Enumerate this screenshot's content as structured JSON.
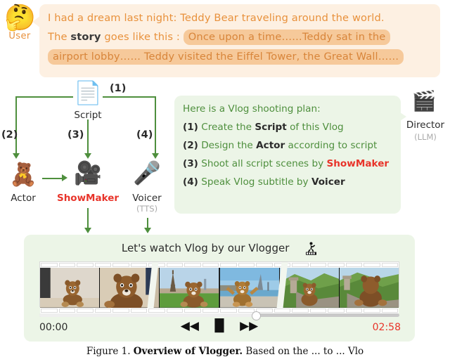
{
  "user": {
    "avatar_icon": "thinking-face-emoji",
    "label": "User",
    "prompt": {
      "line1": "I had a dream last night: Teddy Bear traveling around the world.",
      "line2_pre": "The ",
      "line2_bold": "story",
      "line2_mid": " goes like this : ",
      "line2_highlight": "Once upon a time……Teddy sat in the",
      "line3_highlight": "airport lobby…… Teddy visited the Eiffel Tower, the Great Wall……"
    }
  },
  "diagram": {
    "script": {
      "label": "Script",
      "icon": "document-page-icon"
    },
    "actor": {
      "label": "Actor",
      "icon": "teddy-bear-icon"
    },
    "showmaker": {
      "label": "ShowMaker",
      "icon": "video-camera-icon"
    },
    "voicer": {
      "label": "Voicer",
      "sub": "(TTS)",
      "icon": "microphone-icon"
    },
    "director": {
      "label": "Director",
      "sub": "(LLM)",
      "icon": "clapper-board-icon"
    },
    "steps": [
      "(1)",
      "(2)",
      "(3)",
      "(4)"
    ]
  },
  "plan": {
    "heading": "Here is a Vlog shooting plan:",
    "items": [
      {
        "num": "(1)",
        "pre": "Create the ",
        "kw": "Script",
        "kw_style": "bold",
        "post": " of this Vlog"
      },
      {
        "num": "(2)",
        "pre": "Design the ",
        "kw": "Actor",
        "kw_style": "bold",
        "post": " according to script"
      },
      {
        "num": "(3)",
        "pre": "Shoot all script scenes by ",
        "kw": "ShowMaker",
        "kw_style": "red",
        "post": ""
      },
      {
        "num": "(4)",
        "pre": "Speak Vlog subtitle by ",
        "kw": "Voicer",
        "kw_style": "bold",
        "post": ""
      }
    ]
  },
  "player": {
    "title": "Let's watch Vlog by our Vlogger",
    "logo_icon": "crescent-moon-runner-icon",
    "time_start": "00:00",
    "time_end": "02:58",
    "progress_percent": 60,
    "controls": [
      {
        "name": "rewind-button",
        "glyph": "◀◀"
      },
      {
        "name": "pause-button",
        "glyph": "▐▌"
      },
      {
        "name": "fast-forward-button",
        "glyph": "▶▶"
      }
    ],
    "frames": [
      {
        "name": "frame-indoor-teddy-1",
        "scene": "teddy bear on indoor floor"
      },
      {
        "name": "frame-indoor-teddy-2",
        "scene": "teddy bear closeup indoor"
      },
      {
        "name": "frame-eiffel-teddy",
        "scene": "teddy bear on grass by Eiffel Tower"
      },
      {
        "name": "frame-harbor-teddy",
        "scene": "teddy bear at harbor waterfront"
      },
      {
        "name": "frame-greatwall-teddy-1",
        "scene": "teddy bear on Great Wall ridge"
      },
      {
        "name": "frame-greatwall-teddy-2",
        "scene": "teddy bear back view on Great Wall"
      }
    ]
  },
  "caption": {
    "prefix": "Figure 1. ",
    "bold": "Overview of Vlogger.",
    "rest": " Based on the ... to ... Vlo"
  },
  "colors": {
    "orange": "#e8913c",
    "orange_highlight": "#f6c99a",
    "bubble_bg": "#fdf0e2",
    "green": "#4e8f3d",
    "green_bg": "#ecf5e7",
    "red": "#e8342a",
    "dark": "#2b2b2b"
  }
}
